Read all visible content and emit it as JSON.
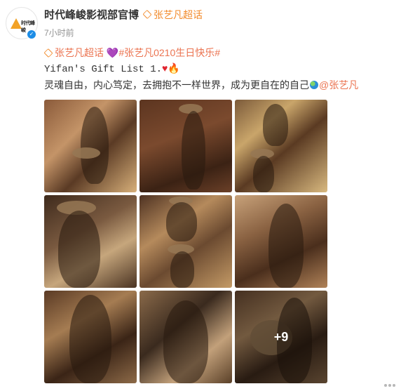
{
  "account": {
    "name": "时代峰峻影视部官博",
    "logo_text": "时代峰峻",
    "supertopic_tag": "张艺凡超话",
    "time": "7小时前"
  },
  "post": {
    "tag1": "张艺凡超话",
    "tag2": "#张艺凡0210生日快乐#",
    "line2": "Yifan's Gift List 1.",
    "line3": "灵魂自由，内心笃定，去拥抱不一样世界，成为更自在的自己",
    "mention": "@张艺凡"
  },
  "gallery": {
    "more_count": "+9"
  },
  "colors": {
    "link": "#eb7350",
    "tag_orange": "#f28a2a",
    "purple_heart": "#7b61d1",
    "verified": "#1d8de6"
  },
  "icons": [
    "supertopic-icon",
    "verified-icon",
    "purple-heart-icon",
    "red-heart-icon",
    "fire-icon",
    "globe-icon",
    "more-dots-icon"
  ]
}
